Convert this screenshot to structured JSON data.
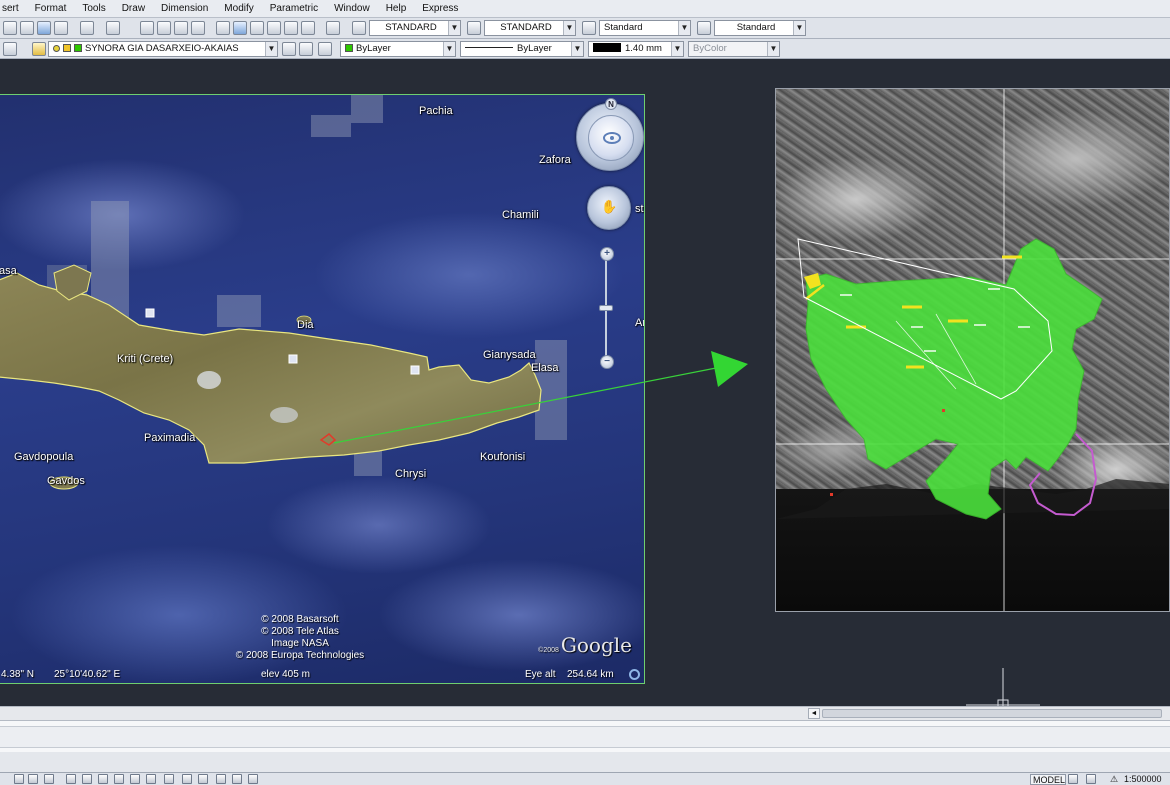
{
  "menu": [
    "sert",
    "Format",
    "Tools",
    "Draw",
    "Dimension",
    "Modify",
    "Parametric",
    "Window",
    "Help",
    "Express"
  ],
  "toolbar1": {
    "text_style": "STANDARD",
    "dim_style": "STANDARD",
    "table_style": "Standard",
    "multileader_style": "Standard"
  },
  "toolbar2": {
    "layer": "SYNORA GIA DASARXEIO-AKAIAS",
    "color": "ByLayer",
    "linetype": "ByLayer",
    "lineweight": "1.40 mm",
    "plotstyle": "ByColor"
  },
  "colors": {
    "accent_green": "#2ec800",
    "canvas_bg": "#272c36",
    "viewport_border": "#6fcf6f",
    "zone_green": "#4be03c",
    "boundary_magenta": "#c55bd0"
  },
  "google_earth": {
    "labels": {
      "pachia": "Pachia",
      "zafora": "Zafora",
      "chamili": "Chamili",
      "dia": "Dia",
      "kriti": "Kriti (Crete)",
      "gianysada": "Gianysada",
      "elasa": "Elasa",
      "paximadia": "Paximadia",
      "gavdopoula": "Gavdopoula",
      "gavdos": "Gavdos",
      "chrysi": "Chrysi",
      "koufonisi": "Koufonisi",
      "left_edge": "asa",
      "right_edge": "Ar",
      "right_edge2": "st"
    },
    "copyright": [
      "© 2008 Basarsoft",
      "© 2008 Tele Atlas",
      "Image NASA",
      "© 2008 Europa Technologies"
    ],
    "logo": "Google",
    "logo_small": "©2008",
    "status": {
      "lat": "4.38\" N",
      "lon": "25°10'40.62\" E",
      "elev": "elev  405 m",
      "eye_alt_label": "Eye alt",
      "eye_alt_value": "254.64 km"
    },
    "nav": {
      "north": "N",
      "zoom_in": "+",
      "zoom_out": "−"
    }
  },
  "status_bar": {
    "model": "MODEL",
    "scale": "1:500000"
  }
}
